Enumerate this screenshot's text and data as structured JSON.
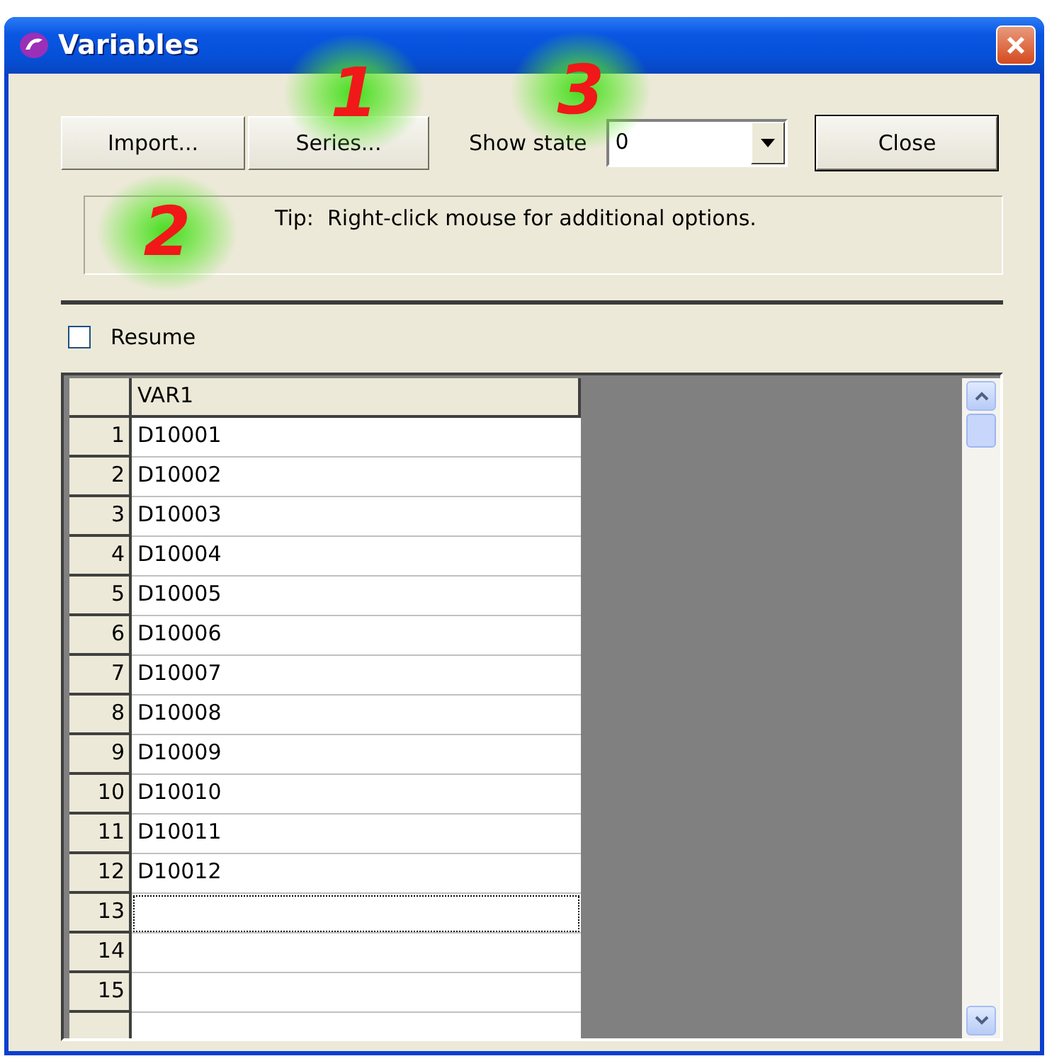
{
  "window": {
    "title": "Variables"
  },
  "annotations": [
    {
      "label": "1"
    },
    {
      "label": "3"
    },
    {
      "label": "2"
    }
  ],
  "toolbar": {
    "buttons": [
      "Import...",
      "Series..."
    ],
    "show_state_label": "Show state",
    "show_state_value": "0",
    "close_button": "Close"
  },
  "tip": "Tip:  Right-click mouse for additional options.",
  "resume": {
    "label": "Resume",
    "checked": false
  },
  "table": {
    "columns": [
      "VAR1"
    ],
    "rows": [
      {
        "number": "1",
        "value": "D10001",
        "focused": false
      },
      {
        "number": "2",
        "value": "D10002",
        "focused": false
      },
      {
        "number": "3",
        "value": "D10003",
        "focused": false
      },
      {
        "number": "4",
        "value": "D10004",
        "focused": false
      },
      {
        "number": "5",
        "value": "D10005",
        "focused": false
      },
      {
        "number": "6",
        "value": "D10006",
        "focused": false
      },
      {
        "number": "7",
        "value": "D10007",
        "focused": false
      },
      {
        "number": "8",
        "value": "D10008",
        "focused": false
      },
      {
        "number": "9",
        "value": "D10009",
        "focused": false
      },
      {
        "number": "10",
        "value": "D10010",
        "focused": false
      },
      {
        "number": "11",
        "value": "D10011",
        "focused": false
      },
      {
        "number": "12",
        "value": "D10012",
        "focused": false
      },
      {
        "number": "13",
        "focused": true
      },
      {
        "number": "14",
        "focused": false
      },
      {
        "number": "15",
        "focused": false
      }
    ]
  }
}
